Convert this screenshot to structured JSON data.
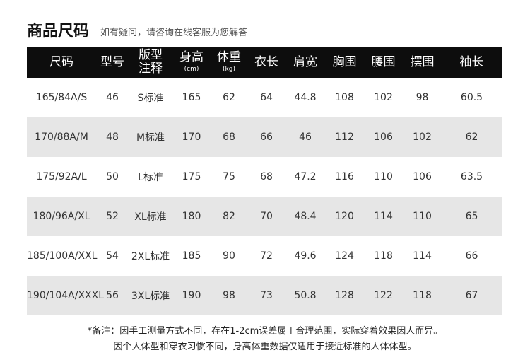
{
  "header": {
    "title": "商品尺码",
    "subtitle": "如有疑问，请咨询在线客服为您解答"
  },
  "table": {
    "columns": [
      {
        "label": "尺码"
      },
      {
        "label": "型号"
      },
      {
        "label": "版型",
        "label2": "注释"
      },
      {
        "label": "身高",
        "unit": "(cm)"
      },
      {
        "label": "体重",
        "unit": "(kg)"
      },
      {
        "label": "衣长"
      },
      {
        "label": "肩宽"
      },
      {
        "label": "胸围"
      },
      {
        "label": "腰围"
      },
      {
        "label": "摆围"
      },
      {
        "label": "袖长"
      }
    ],
    "rows": [
      [
        "165/84A/S",
        "46",
        "S标准",
        "165",
        "62",
        "64",
        "44.8",
        "108",
        "102",
        "98",
        "60.5"
      ],
      [
        "170/88A/M",
        "48",
        "M标准",
        "170",
        "68",
        "66",
        "46",
        "112",
        "106",
        "102",
        "62"
      ],
      [
        "175/92A/L",
        "50",
        "L标准",
        "175",
        "75",
        "68",
        "47.2",
        "116",
        "110",
        "106",
        "63.5"
      ],
      [
        "180/96A/XL",
        "52",
        "XL标准",
        "180",
        "82",
        "70",
        "48.4",
        "120",
        "114",
        "110",
        "65"
      ],
      [
        "185/100A/XXL",
        "54",
        "2XL标准",
        "185",
        "90",
        "72",
        "49.6",
        "124",
        "118",
        "114",
        "66"
      ],
      [
        "190/104A/XXXL",
        "56",
        "3XL标准",
        "190",
        "98",
        "73",
        "50.8",
        "128",
        "122",
        "118",
        "67"
      ]
    ]
  },
  "notes": {
    "line1": "*备注：因手工测量方式不同，存在1-2cm误差属于合理范围，实际穿着效果因人而异。",
    "line2": "因个人体型和穿衣习惯不同，身高体重数据仅适用于接近标准的人体体型。"
  }
}
